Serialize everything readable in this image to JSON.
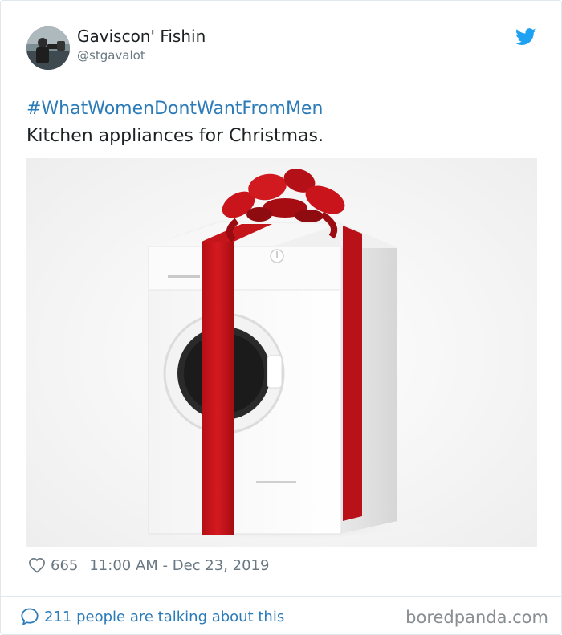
{
  "tweet": {
    "author": {
      "display_name": "Gaviscon' Fishin",
      "handle": "@stgavalot"
    },
    "hashtag": "#WhatWomenDontWantFromMen",
    "text": "Kitchen appliances for Christmas.",
    "likes": "665",
    "timestamp": "11:00 AM - Dec 23, 2019",
    "talking_about": "211 people are talking about this"
  },
  "watermark": "boredpanda.com",
  "icons": {
    "brand": "twitter-bird-icon",
    "like": "heart-icon",
    "reply": "speech-bubble-icon"
  },
  "colors": {
    "link": "#2b7bb9",
    "twitter_blue": "#1da1f2",
    "muted_text": "#697882",
    "text": "#1c2022",
    "ribbon_red": "#c8141a"
  }
}
